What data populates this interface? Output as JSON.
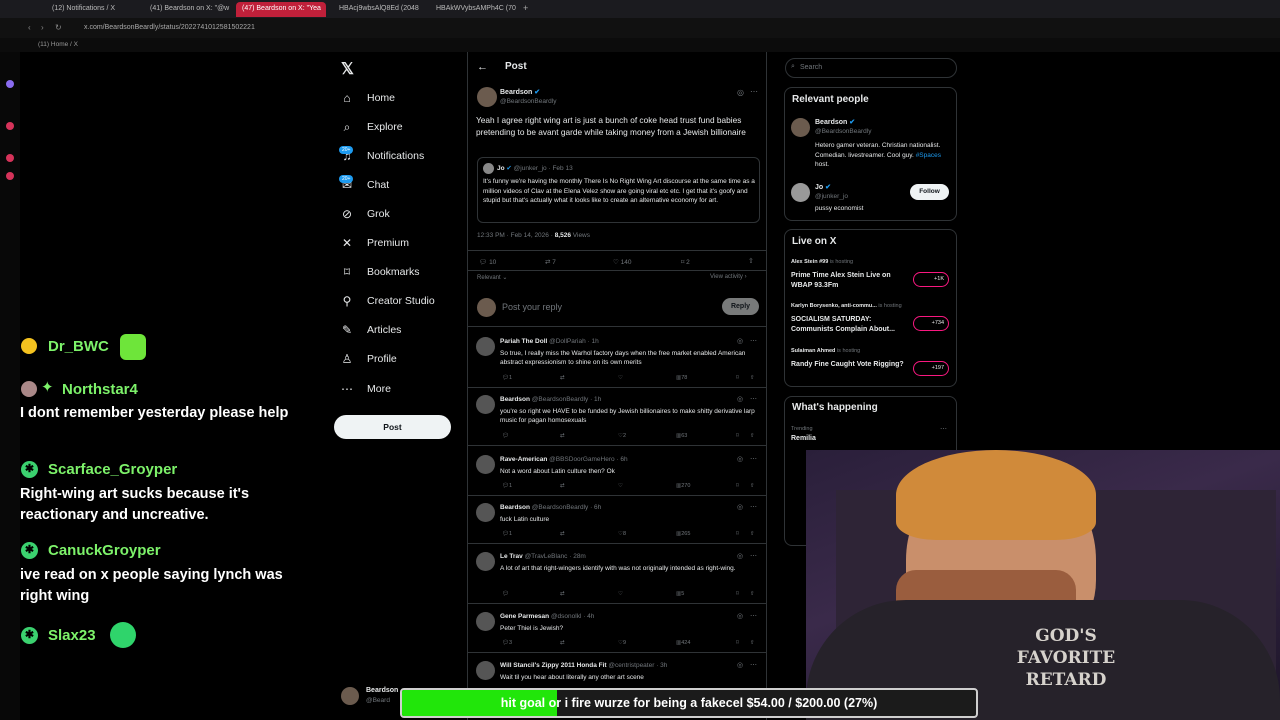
{
  "browser": {
    "tabs": [
      {
        "label": "(12) Notifications / X",
        "active": false
      },
      {
        "label": "(41) Beardson on X: \"@w",
        "active": false
      },
      {
        "label": "(47) Beardson on X: \"Yea",
        "active": true
      },
      {
        "label": "HBAcj9wbsAlQ8Ed (2048",
        "active": false
      },
      {
        "label": "HBAkWVybsAMPh4C (70",
        "active": false
      }
    ],
    "url": "x.com/BeardsonBeardly/status/2022741012581502221",
    "bookmark_label": "(11) Home / X"
  },
  "chat": [
    {
      "name": "Dr_BWC",
      "message": ""
    },
    {
      "name": "Northstar4",
      "message": "I dont remember yesterday please help"
    },
    {
      "name": "Scarface_Groyper",
      "message": "Right-wing art sucks because it's reactionary and uncreative."
    },
    {
      "name": "CanuckGroyper",
      "message": "ive read on x people saying lynch was right wing"
    },
    {
      "name": "Slax23",
      "message": ""
    }
  ],
  "nav": {
    "items": [
      "Home",
      "Explore",
      "Notifications",
      "Chat",
      "Grok",
      "Premium",
      "Bookmarks",
      "Creator Studio",
      "Articles",
      "Profile",
      "More"
    ],
    "badge": "20+",
    "post_label": "Post",
    "account_name": "Beardson",
    "account_handle": "@Beard"
  },
  "post": {
    "header": "Post",
    "author": "Beardson",
    "handle": "@BeardsonBeardly",
    "text": "Yeah I agree right wing art is just a bunch of coke head trust fund babies pretending to be avant garde while taking money from a Jewish billionaire",
    "quote": {
      "author": "Jo",
      "handle": "@junker_jo",
      "date": "Feb 13",
      "text": "It's funny we're having the monthly There Is No Right Wing Art discourse at the same time as a million videos of Clav at the Elena Velez show are going viral etc etc. I get that it's goofy and stupid but that's actually what it looks like to create an alternative economy for art."
    },
    "timestamp": "12:33 PM · Feb 14, 2026 · ",
    "views": "8,526",
    "views_label": "Views",
    "stats": {
      "replies": "10",
      "reposts": "7",
      "likes": "140",
      "bookmarks": "2"
    },
    "sort_label": "Relevant",
    "view_activity": "View activity",
    "reply_placeholder": "Post your reply",
    "reply_button": "Reply"
  },
  "replies": [
    {
      "name": "Pariah The Doll",
      "handle": "@DollPariah · 1h",
      "text": "So true, I really miss the Warhol factory days when the free market enabled American abstract expressionism to shine on its own merits",
      "replies": "1",
      "likes": "",
      "views": "78"
    },
    {
      "name": "Beardson",
      "handle": "@BeardsonBeardly · 1h",
      "text": "you're so right we HAVE to be funded by Jewish billionaires to make shitty derivative larp music for pagan homosexuals",
      "replies": "",
      "likes": "2",
      "views": "63"
    },
    {
      "name": "Rave-American",
      "handle": "@BBSDoorGameHero · 6h",
      "text": "Not a word about Latin culture then? Ok",
      "replies": "1",
      "likes": "",
      "views": "270"
    },
    {
      "name": "Beardson",
      "handle": "@BeardsonBeardly · 6h",
      "text": "fuck Latin culture",
      "replies": "1",
      "likes": "8",
      "views": "265"
    },
    {
      "name": "Le Trav",
      "handle": "@TravLeBlanc · 28m",
      "text": "A lot of art that right-wingers identify with was not originally intended as right-wing.",
      "replies": "",
      "likes": "",
      "views": "5"
    },
    {
      "name": "Gene Parmesan",
      "handle": "@dsonolkl · 4h",
      "text": "Peter Thiel is Jewish?",
      "replies": "3",
      "likes": "9",
      "views": "424"
    },
    {
      "name": "Will Stancil's Zippy 2011 Honda Fit",
      "handle": "@centristpeater · 3h",
      "text": "Wait til you hear about literally any other art scene",
      "replies": "",
      "likes": "",
      "views": ""
    }
  ],
  "right": {
    "search_placeholder": "Search",
    "relevant_title": "Relevant people",
    "people": [
      {
        "name": "Beardson",
        "handle": "@BeardsonBeardly",
        "bio": "Hetero gamer veteran. Christian nationalist. Comedian. livestreamer. Cool guy. ",
        "bio_link": "#Spaces",
        "bio_end": " host."
      },
      {
        "name": "Jo",
        "handle": "@junker_jo",
        "bio": "pussy economist",
        "follow": "Follow"
      }
    ],
    "live_title": "Live on X",
    "live": [
      {
        "host": "Alex Stein #99",
        "status": "is hosting",
        "title": "Prime Time Alex Stein Live on WBAP 93.3Fm",
        "count": "+1K"
      },
      {
        "host": "Karlyn Borysenko, anti-commu...",
        "status": "is hosting",
        "title": "SOCIALISM SATURDAY: Communists Complain About...",
        "count": "+734"
      },
      {
        "host": "Sulaiman Ahmed",
        "status": "is hosting",
        "title": "Randy Fine Caught Vote Rigging?",
        "count": "+197"
      }
    ],
    "happening_title": "What's happening",
    "trend_label": "Trending",
    "trend": "Remilia"
  },
  "overlay": {
    "goal_text": "hit goal or i fire wurze for being a fakecel $54.00 / $200.00 (27%)",
    "goal_progress": 0.27,
    "shirt_text": "GOD'S FAVORITE RETARD"
  }
}
